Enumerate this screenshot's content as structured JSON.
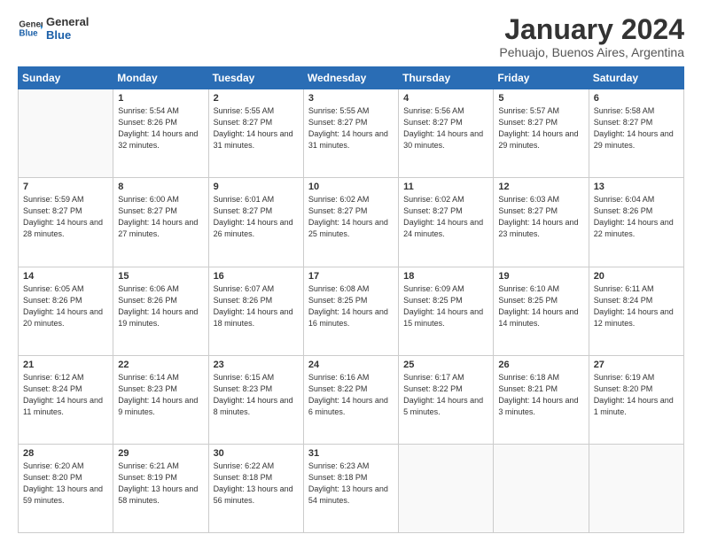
{
  "logo": {
    "line1": "General",
    "line2": "Blue"
  },
  "title": "January 2024",
  "subtitle": "Pehuajo, Buenos Aires, Argentina",
  "days_of_week": [
    "Sunday",
    "Monday",
    "Tuesday",
    "Wednesday",
    "Thursday",
    "Friday",
    "Saturday"
  ],
  "weeks": [
    [
      {
        "day": "",
        "content": ""
      },
      {
        "day": "1",
        "content": "Sunrise: 5:54 AM\nSunset: 8:26 PM\nDaylight: 14 hours\nand 32 minutes."
      },
      {
        "day": "2",
        "content": "Sunrise: 5:55 AM\nSunset: 8:27 PM\nDaylight: 14 hours\nand 31 minutes."
      },
      {
        "day": "3",
        "content": "Sunrise: 5:55 AM\nSunset: 8:27 PM\nDaylight: 14 hours\nand 31 minutes."
      },
      {
        "day": "4",
        "content": "Sunrise: 5:56 AM\nSunset: 8:27 PM\nDaylight: 14 hours\nand 30 minutes."
      },
      {
        "day": "5",
        "content": "Sunrise: 5:57 AM\nSunset: 8:27 PM\nDaylight: 14 hours\nand 29 minutes."
      },
      {
        "day": "6",
        "content": "Sunrise: 5:58 AM\nSunset: 8:27 PM\nDaylight: 14 hours\nand 29 minutes."
      }
    ],
    [
      {
        "day": "7",
        "content": "Sunrise: 5:59 AM\nSunset: 8:27 PM\nDaylight: 14 hours\nand 28 minutes."
      },
      {
        "day": "8",
        "content": "Sunrise: 6:00 AM\nSunset: 8:27 PM\nDaylight: 14 hours\nand 27 minutes."
      },
      {
        "day": "9",
        "content": "Sunrise: 6:01 AM\nSunset: 8:27 PM\nDaylight: 14 hours\nand 26 minutes."
      },
      {
        "day": "10",
        "content": "Sunrise: 6:02 AM\nSunset: 8:27 PM\nDaylight: 14 hours\nand 25 minutes."
      },
      {
        "day": "11",
        "content": "Sunrise: 6:02 AM\nSunset: 8:27 PM\nDaylight: 14 hours\nand 24 minutes."
      },
      {
        "day": "12",
        "content": "Sunrise: 6:03 AM\nSunset: 8:27 PM\nDaylight: 14 hours\nand 23 minutes."
      },
      {
        "day": "13",
        "content": "Sunrise: 6:04 AM\nSunset: 8:26 PM\nDaylight: 14 hours\nand 22 minutes."
      }
    ],
    [
      {
        "day": "14",
        "content": "Sunrise: 6:05 AM\nSunset: 8:26 PM\nDaylight: 14 hours\nand 20 minutes."
      },
      {
        "day": "15",
        "content": "Sunrise: 6:06 AM\nSunset: 8:26 PM\nDaylight: 14 hours\nand 19 minutes."
      },
      {
        "day": "16",
        "content": "Sunrise: 6:07 AM\nSunset: 8:26 PM\nDaylight: 14 hours\nand 18 minutes."
      },
      {
        "day": "17",
        "content": "Sunrise: 6:08 AM\nSunset: 8:25 PM\nDaylight: 14 hours\nand 16 minutes."
      },
      {
        "day": "18",
        "content": "Sunrise: 6:09 AM\nSunset: 8:25 PM\nDaylight: 14 hours\nand 15 minutes."
      },
      {
        "day": "19",
        "content": "Sunrise: 6:10 AM\nSunset: 8:25 PM\nDaylight: 14 hours\nand 14 minutes."
      },
      {
        "day": "20",
        "content": "Sunrise: 6:11 AM\nSunset: 8:24 PM\nDaylight: 14 hours\nand 12 minutes."
      }
    ],
    [
      {
        "day": "21",
        "content": "Sunrise: 6:12 AM\nSunset: 8:24 PM\nDaylight: 14 hours\nand 11 minutes."
      },
      {
        "day": "22",
        "content": "Sunrise: 6:14 AM\nSunset: 8:23 PM\nDaylight: 14 hours\nand 9 minutes."
      },
      {
        "day": "23",
        "content": "Sunrise: 6:15 AM\nSunset: 8:23 PM\nDaylight: 14 hours\nand 8 minutes."
      },
      {
        "day": "24",
        "content": "Sunrise: 6:16 AM\nSunset: 8:22 PM\nDaylight: 14 hours\nand 6 minutes."
      },
      {
        "day": "25",
        "content": "Sunrise: 6:17 AM\nSunset: 8:22 PM\nDaylight: 14 hours\nand 5 minutes."
      },
      {
        "day": "26",
        "content": "Sunrise: 6:18 AM\nSunset: 8:21 PM\nDaylight: 14 hours\nand 3 minutes."
      },
      {
        "day": "27",
        "content": "Sunrise: 6:19 AM\nSunset: 8:20 PM\nDaylight: 14 hours\nand 1 minute."
      }
    ],
    [
      {
        "day": "28",
        "content": "Sunrise: 6:20 AM\nSunset: 8:20 PM\nDaylight: 13 hours\nand 59 minutes."
      },
      {
        "day": "29",
        "content": "Sunrise: 6:21 AM\nSunset: 8:19 PM\nDaylight: 13 hours\nand 58 minutes."
      },
      {
        "day": "30",
        "content": "Sunrise: 6:22 AM\nSunset: 8:18 PM\nDaylight: 13 hours\nand 56 minutes."
      },
      {
        "day": "31",
        "content": "Sunrise: 6:23 AM\nSunset: 8:18 PM\nDaylight: 13 hours\nand 54 minutes."
      },
      {
        "day": "",
        "content": ""
      },
      {
        "day": "",
        "content": ""
      },
      {
        "day": "",
        "content": ""
      }
    ]
  ]
}
